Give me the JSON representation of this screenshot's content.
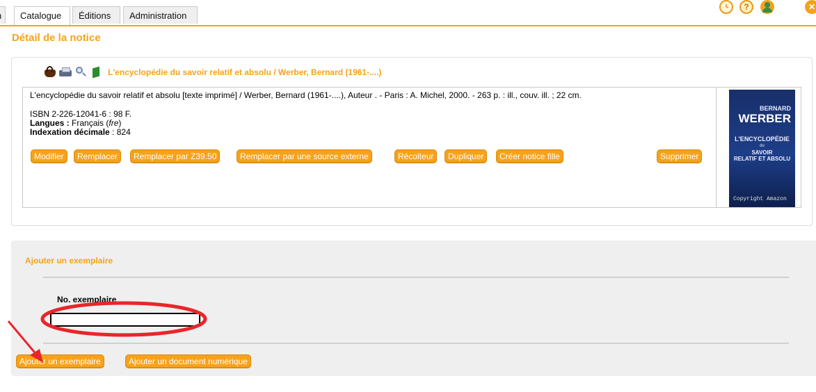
{
  "tabs": {
    "partial": "n",
    "catalogue": "Catalogue",
    "editions": "Éditions",
    "administration": "Administration"
  },
  "top_icons": {
    "help_glyph": "?",
    "close_glyph": "✕"
  },
  "page": {
    "title": "Détail de la notice"
  },
  "record": {
    "header_title": "L'encyclopédie du savoir relatif et absolu / Werber, Bernard (1961-....)",
    "description": "L'encyclopédie du savoir relatif et absolu [texte imprimé] / Werber, Bernard (1961-....), Auteur . - Paris : A. Michel, 2000. - 263 p. : ill., couv. ill. ; 22 cm.",
    "isbn": "ISBN 2-226-12041-6 : 98 F.",
    "langues_label": "Langues :",
    "langues_value": "Français",
    "langues_code": "fre",
    "indexation_label": "Indexation décimale",
    "indexation_value": ": 824",
    "buttons": {
      "modifier": "Modifier",
      "remplacer": "Remplacer",
      "remplacer_z3950": "Remplacer par Z39.50",
      "remplacer_externe": "Remplacer par une source externe",
      "recolteur": "Récolteur",
      "dupliquer": "Dupliquer",
      "creer_fille": "Créer notice fille",
      "supprimer": "Supprimer"
    },
    "cover": {
      "author_first": "BERNARD",
      "author_last": "WERBER",
      "title1": "L'ENCYCLOPÉDIE",
      "title2": "du",
      "title3": "SAVOIR",
      "title4": "RELATIF ET ABSOLU",
      "copyright": "Copyright Amazon"
    }
  },
  "add_copy": {
    "title": "Ajouter un exemplaire",
    "field_label": "No. exemplaire",
    "field_value": "",
    "add_button": "Ajouter un exemplaire",
    "add_digital_button": "Ajouter un document numérique"
  },
  "colors": {
    "accent": "#f7a21b",
    "annotation": "#e8262a",
    "panel_bg": "#efefef"
  }
}
